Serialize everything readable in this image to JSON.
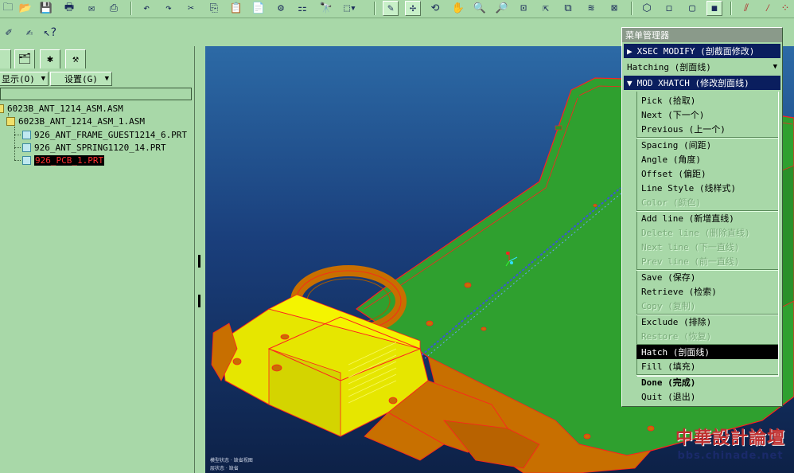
{
  "toolbar": {
    "icons": [
      "folder-icon",
      "open-icon",
      "save-icon",
      "print-icon",
      "send-icon",
      "print-preview-icon",
      "undo-icon",
      "redo-icon",
      "cut-icon",
      "copy-icon",
      "paste-icon",
      "paste-special-icon",
      "regenerate-icon",
      "mapkey-icon",
      "select-box-icon",
      "repaint-icon",
      "spin-center-icon",
      "orient-icon",
      "pan-icon",
      "zoom-in-icon",
      "zoom-out-icon",
      "refit-icon",
      "reorient-icon",
      "saved-views-icon",
      "layers-icon",
      "env-icon",
      "wireframe-icon",
      "hidden-line-icon",
      "no-hidden-icon",
      "shading-icon",
      "datum-plane-icon",
      "datum-axis-icon",
      "datum-point-icon"
    ]
  },
  "toolbar2": {
    "icons": [
      "model-tree-icon",
      "context-help-icon",
      "whats-this-icon"
    ]
  },
  "left_panel": {
    "tabs": [
      "model-tree-tab",
      "folder-browser-tab",
      "favorites-tab",
      "connections-tab"
    ],
    "menus": {
      "show": "显示(O)",
      "settings": "设置(G)"
    },
    "tree": [
      {
        "label": "6023B_ANT_1214_ASM.ASM",
        "type": "asm"
      },
      {
        "label": "6023B_ANT_1214_ASM_1.ASM",
        "type": "asm"
      },
      {
        "label": "926_ANT_FRAME_GUEST1214_6.PRT",
        "type": "prt"
      },
      {
        "label": "926_ANT_SPRING1120_14.PRT",
        "type": "prt"
      },
      {
        "label": "926_PCB_1.PRT",
        "type": "prt",
        "selected": true
      }
    ]
  },
  "menu_manager": {
    "title": "菜单管理器",
    "xsec_modify": "XSEC MODIFY (剖截面修改)",
    "hatching": "Hatching (剖面线)",
    "mod_xhatch": "MOD XHATCH (修改剖面线)",
    "items": {
      "pick": "Pick (拾取)",
      "next": "Next (下一个)",
      "previous": "Previous (上一个)",
      "spacing": "Spacing (间距)",
      "angle": "Angle (角度)",
      "offset": "Offset (偏距)",
      "line_style": "Line Style (线样式)",
      "color": "Color (颜色)",
      "add_line": "Add line (新增直线)",
      "delete_line": "Delete line (删除直线)",
      "next_line": "Next line (下一直线)",
      "prev_line": "Prev line (前一直线)",
      "save": "Save (保存)",
      "retrieve": "Retrieve (检索)",
      "copy": "Copy (复制)",
      "exclude": "Exclude (排除)",
      "restore": "Restore (恢复)",
      "hatch": "Hatch (剖面线)",
      "fill": "Fill (填充)",
      "done": "Done (完成)",
      "quit": "Quit (退出)"
    }
  },
  "watermark": {
    "line1": "中華設計論壇",
    "line2": "bbs.chinade.net"
  },
  "colors": {
    "pcb_green": "#2fa02f",
    "part_yellow": "#e6e600",
    "part_orange": "#c86f00",
    "edge_red": "#ff2020",
    "active_item": "#000000",
    "header_navy": "#0a1e5e"
  }
}
